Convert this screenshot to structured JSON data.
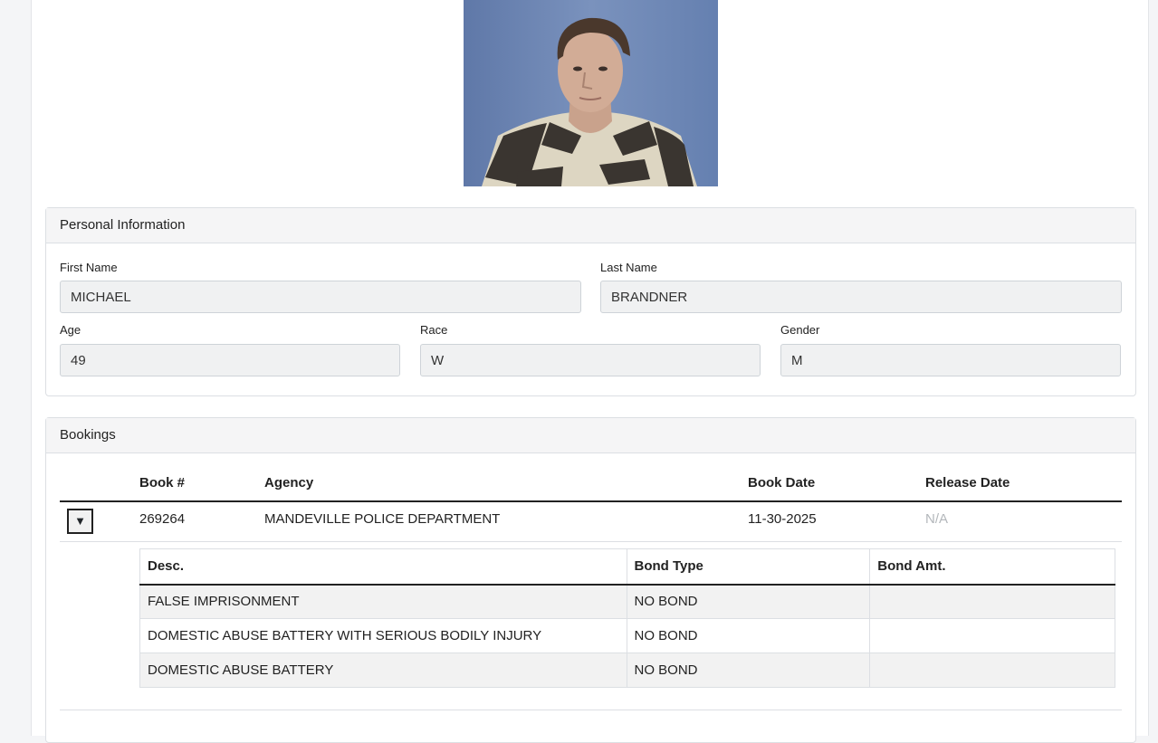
{
  "personal": {
    "header": "Personal Information",
    "first_name_label": "First Name",
    "first_name": "MICHAEL",
    "last_name_label": "Last Name",
    "last_name": "BRANDNER",
    "age_label": "Age",
    "age": "49",
    "race_label": "Race",
    "race": "W",
    "gender_label": "Gender",
    "gender": "M"
  },
  "bookings": {
    "header": "Bookings",
    "columns": {
      "book_no": "Book #",
      "agency": "Agency",
      "book_date": "Book Date",
      "release_date": "Release Date"
    },
    "rows": [
      {
        "toggle": "▼",
        "book_no": "269264",
        "agency": "MANDEVILLE POLICE DEPARTMENT",
        "book_date": "11-30-2025",
        "release_date": "N/A"
      }
    ],
    "charges": {
      "columns": {
        "desc": "Desc.",
        "bond_type": "Bond Type",
        "bond_amt": "Bond Amt."
      },
      "rows": [
        {
          "desc": "FALSE IMPRISONMENT",
          "bond_type": "NO BOND",
          "bond_amt": ""
        },
        {
          "desc": "DOMESTIC ABUSE BATTERY WITH SERIOUS BODILY INJURY",
          "bond_type": "NO BOND",
          "bond_amt": ""
        },
        {
          "desc": "DOMESTIC ABUSE BATTERY",
          "bond_type": "NO BOND",
          "bond_amt": ""
        }
      ]
    }
  },
  "colors": {
    "na_text": "#b3b7bb",
    "panel_header_bg": "#f5f5f6",
    "field_bg": "#f0f1f2"
  }
}
